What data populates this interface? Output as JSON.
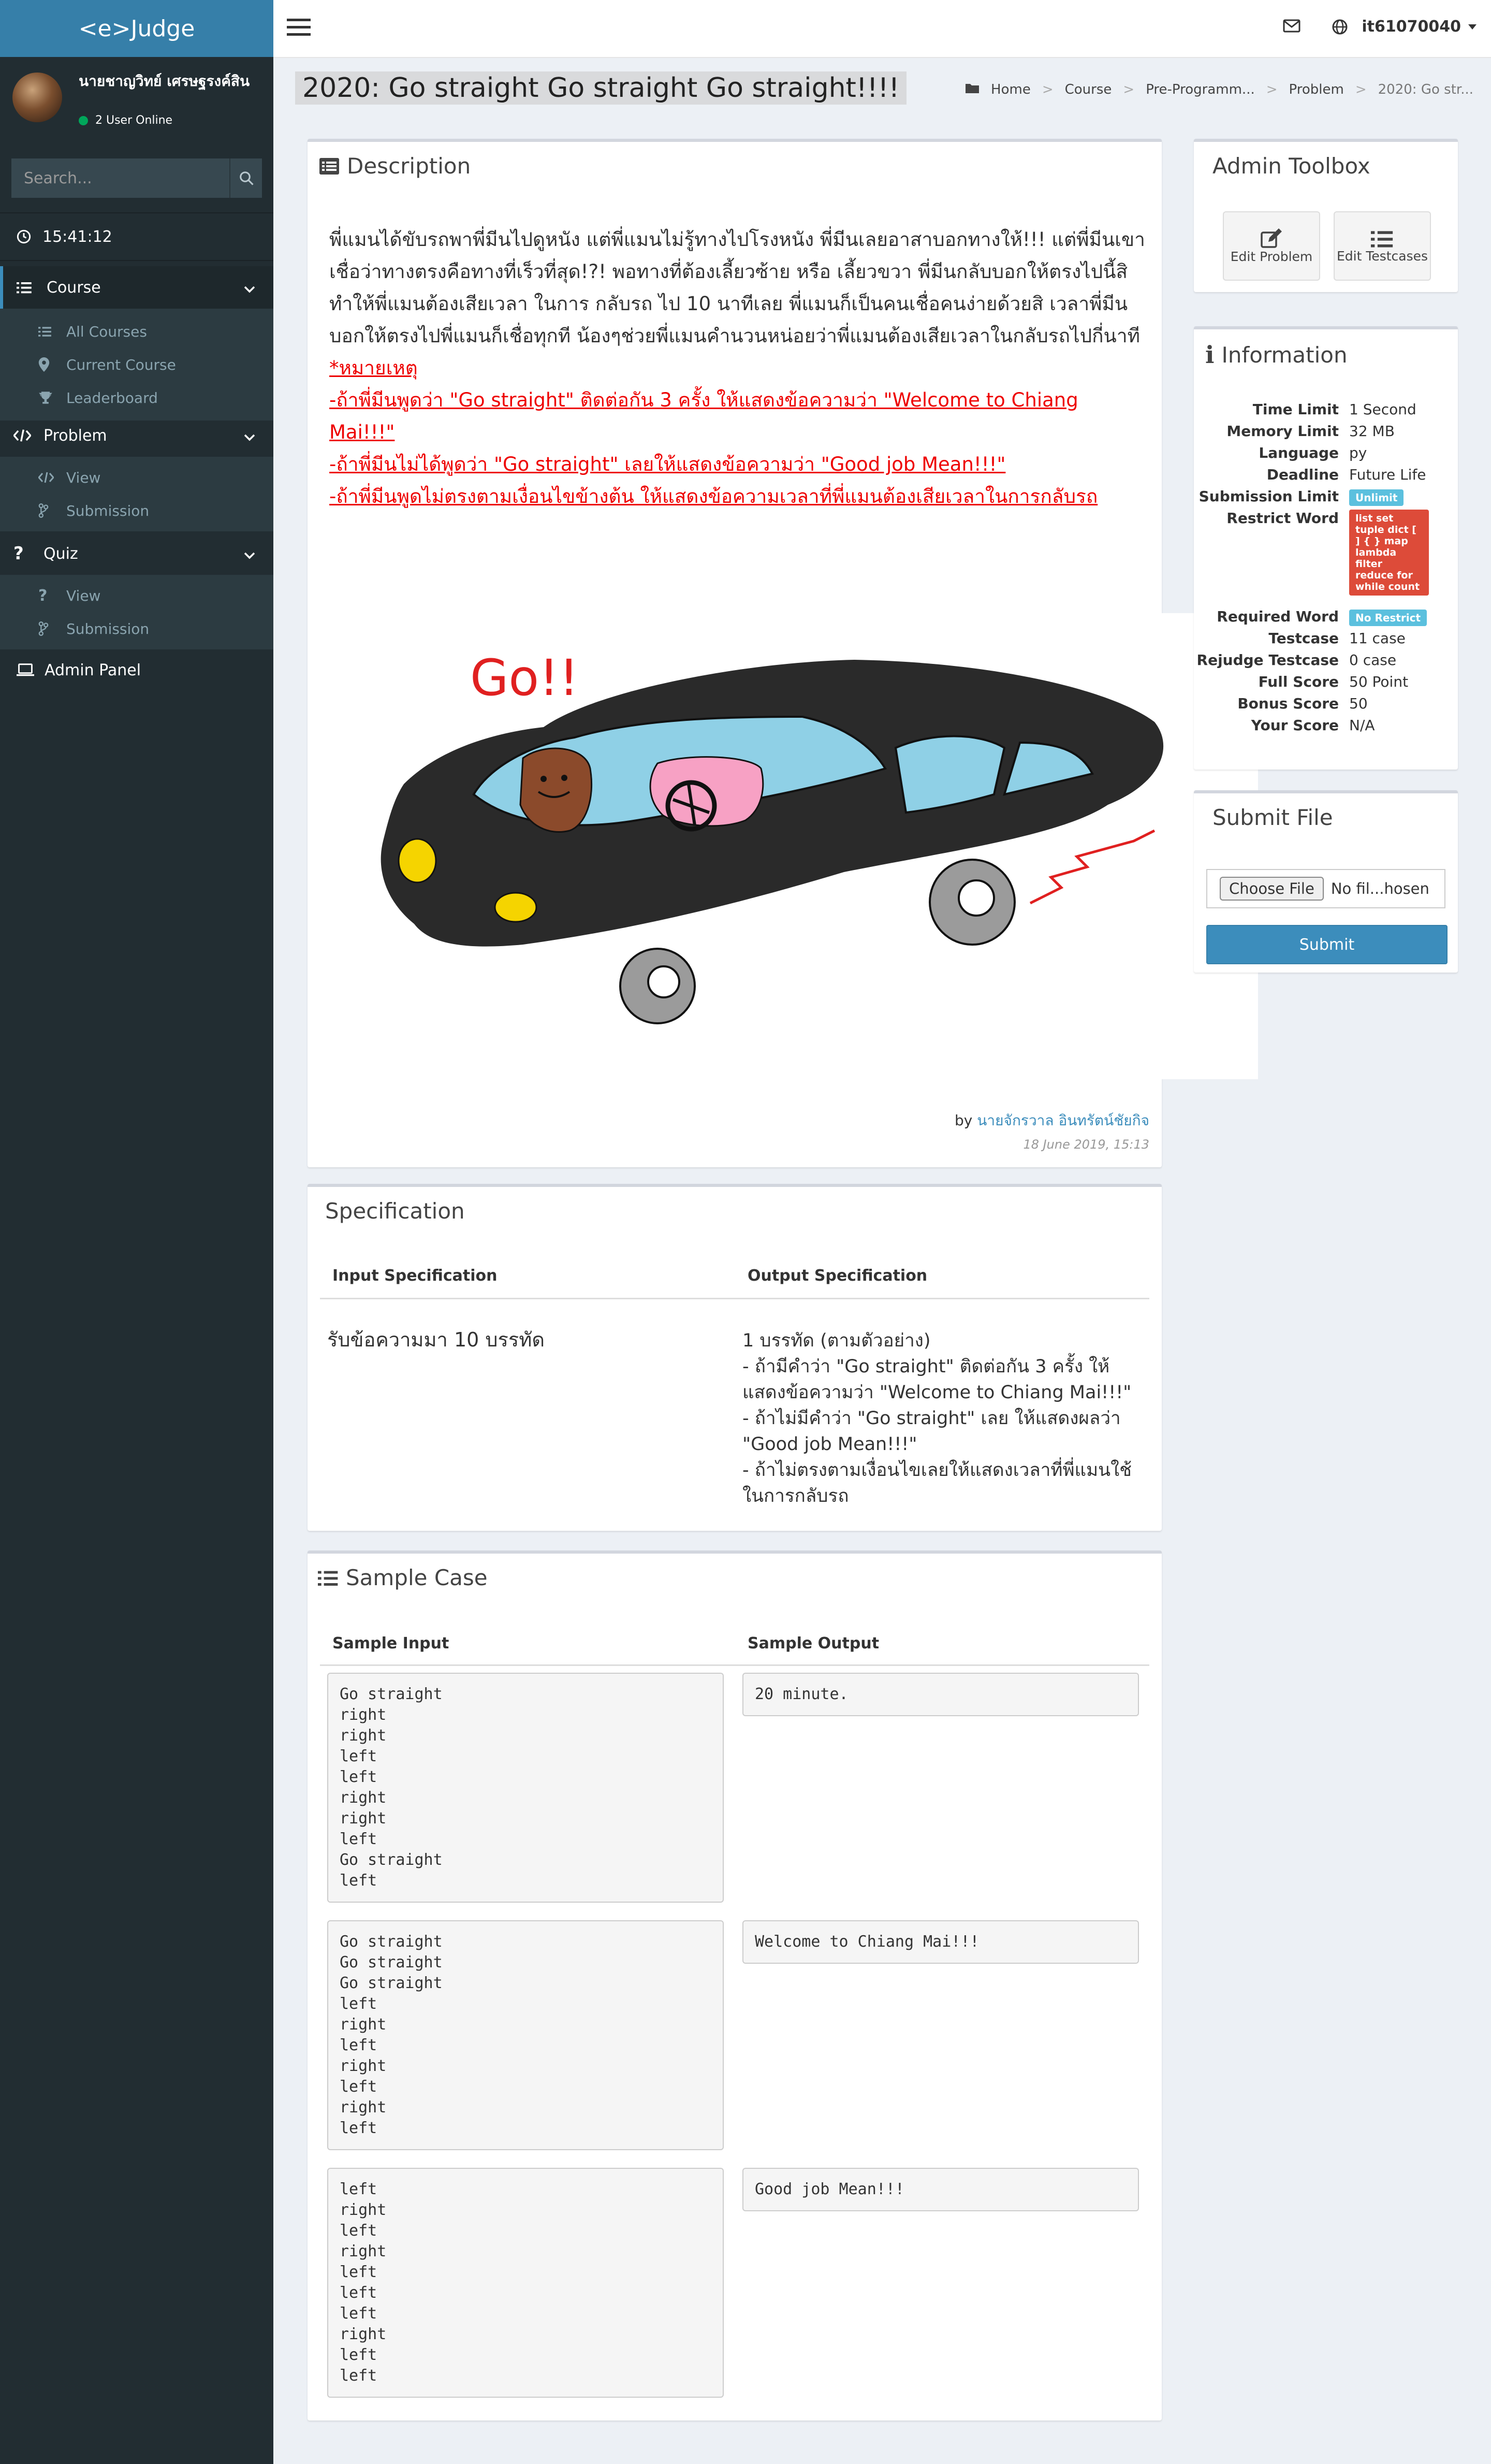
{
  "sidebar": {
    "brand": "<e>Judge",
    "user_name": "นายชาญวิทย์ เศรษฐรงค์สิน",
    "online_text": "2 User Online",
    "search_placeholder": "Search...",
    "clock": "15:41:12",
    "course": {
      "label": "Course",
      "items": [
        "All Courses",
        "Current Course",
        "Leaderboard"
      ]
    },
    "problem": {
      "label": "Problem",
      "items": [
        "View",
        "Submission"
      ]
    },
    "quiz": {
      "label": "Quiz",
      "items": [
        "View",
        "Submission"
      ]
    },
    "admin_panel": "Admin Panel"
  },
  "topbar": {
    "username": "it61070040"
  },
  "page": {
    "title": "2020: Go straight Go straight Go straight!!!!",
    "breadcrumb": [
      "Home",
      "Course",
      "Pre-Programm...",
      "Problem",
      "2020: Go str..."
    ]
  },
  "description": {
    "heading": "Description",
    "paragraph": "พี่แมนได้ขับรถพาพี่มีนไปดูหนัง แต่พี่แมนไม่รู้ทางไปโรงหนัง พี่มีนเลยอาสาบอกทางให้!!! แต่พี่มีนเขาเชื่อว่าทางตรงคือทางที่เร็วที่สุด!?! พอทางที่ต้องเลี้ยวซ้าย หรือ เลี้ยวขวา พี่มีนกลับบอกให้ตรงไปนี้สิ ทำให้พี่แมนต้องเสียเวลา ในการ กลับรถ ไป 10 นาทีเลย พี่แมนก็เป็นคนเชื่อคนง่ายด้วยสิ เวลาพี่มีนบอกให้ตรงไปพี่แมนก็เชื่อทุกที น้องๆช่วยพี่แมนคำนวนหน่อยว่าพี่แมนต้องเสียเวลาในกลับรถไปกี่นาที",
    "notes": [
      "*หมายเหตุ",
      "-ถ้าพี่มีนพูดว่า \"Go straight\" ติดต่อกัน 3 ครั้ง ให้แสดงข้อความว่า \"Welcome to Chiang Mai!!!\"",
      "-ถ้าพี่มีนไม่ได้พูดว่า \"Go straight\" เลยให้แสดงข้อความว่า \"Good job Mean!!!\"",
      "-ถ้าพี่มีนพูดไม่ตรงตามเงื่อนไขข้างต้น ให้แสดงข้อความเวลาที่พี่แมนต้องเสียเวลาในการกลับรถ"
    ],
    "image_text": "Go!!",
    "by_label": "by",
    "author": "นายจักรวาล อินทรัตน์ชัยกิจ",
    "date": "18 June 2019, 15:13"
  },
  "specification": {
    "heading": "Specification",
    "input_label": "Input Specification",
    "output_label": "Output Specification",
    "input_text": "รับข้อความมา 10 บรรทัด",
    "output_lines": [
      "1 บรรทัด (ตามตัวอย่าง)",
      "- ถ้ามีคำว่า \"Go straight\" ติดต่อกัน 3 ครั้ง ให้ แสดงข้อความว่า \"Welcome to Chiang Mai!!!\"",
      "- ถ้าไม่มีคำว่า  \"Go straight\" เลย ให้แสดงผลว่า \"Good job Mean!!!\"",
      "- ถ้าไม่ตรงตามเงื่อนไขเลยให้แสดงเวลาที่พี่แมนใช้ในการกลับรถ"
    ]
  },
  "sample": {
    "heading": "Sample Case",
    "input_label": "Sample Input",
    "output_label": "Sample Output",
    "cases": [
      {
        "input": "Go straight\nright\nright\nleft\nleft\nright\nright\nleft\nGo straight\nleft",
        "output": "20 minute."
      },
      {
        "input": "Go straight\nGo straight\nGo straight\nleft\nright\nleft\nright\nleft\nright\nleft",
        "output": "Welcome to Chiang Mai!!!"
      },
      {
        "input": "left\nright\nleft\nright\nleft\nleft\nleft\nright\nleft\nleft",
        "output": "Good job Mean!!!"
      }
    ]
  },
  "admin_toolbox": {
    "heading": "Admin Toolbox",
    "edit_problem": "Edit Problem",
    "edit_testcases": "Edit Testcases"
  },
  "information": {
    "heading": "Information",
    "rows": [
      {
        "key": "Time Limit",
        "value": "1 Second"
      },
      {
        "key": "Memory Limit",
        "value": "32 MB"
      },
      {
        "key": "Language",
        "value": "py"
      },
      {
        "key": "Deadline",
        "value": "Future Life"
      },
      {
        "key": "Submission Limit",
        "value": "Unlimit"
      },
      {
        "key": "Restrict Word",
        "value": "list set tuple dict [ ] { } map lambda filter reduce for while count"
      },
      {
        "key": "Required Word",
        "value": "No Restrict"
      },
      {
        "key": "Testcase",
        "value": "11 case"
      },
      {
        "key": "Rejudge Testcase",
        "value": "0 case"
      },
      {
        "key": "Full Score",
        "value": "50 Point"
      },
      {
        "key": "Bonus Score",
        "value": "50"
      },
      {
        "key": "Your Score",
        "value": "N/A"
      }
    ]
  },
  "submit": {
    "heading": "Submit File",
    "choose_label": "Choose File",
    "file_status": "No fil...hosen",
    "submit_label": "Submit"
  },
  "colors": {
    "accent": "#3c8dbc",
    "sidebar": "#222d32",
    "note_red": "#ee0000",
    "badge_blue": "#5bc0de",
    "badge_red": "#dd4b39"
  }
}
